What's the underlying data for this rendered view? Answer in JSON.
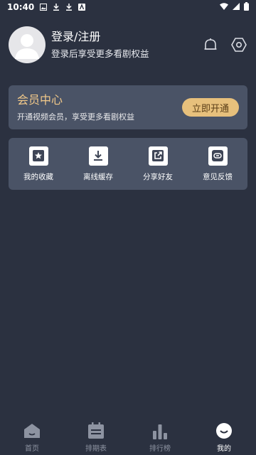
{
  "status_bar": {
    "time": "10:40"
  },
  "profile": {
    "title": "登录/注册",
    "subtitle": "登录后享受更多看剧权益"
  },
  "vip": {
    "title": "会员中心",
    "subtitle": "开通视频会员，享受更多看剧权益",
    "button": "立即开通"
  },
  "functions": [
    {
      "label": "我的收藏",
      "icon": "star-icon"
    },
    {
      "label": "离线缓存",
      "icon": "download-icon"
    },
    {
      "label": "分享好友",
      "icon": "share-icon"
    },
    {
      "label": "意见反馈",
      "icon": "feedback-icon"
    }
  ],
  "nav": [
    {
      "label": "首页",
      "icon": "home-icon",
      "active": false
    },
    {
      "label": "排期表",
      "icon": "calendar-icon",
      "active": false
    },
    {
      "label": "排行榜",
      "icon": "chart-icon",
      "active": false
    },
    {
      "label": "我的",
      "icon": "smile-icon",
      "active": true
    }
  ],
  "colors": {
    "background": "#2b3140",
    "card": "#4a5366",
    "accent_gold": "#e7c07c",
    "nav_inactive": "#8d93a1"
  }
}
